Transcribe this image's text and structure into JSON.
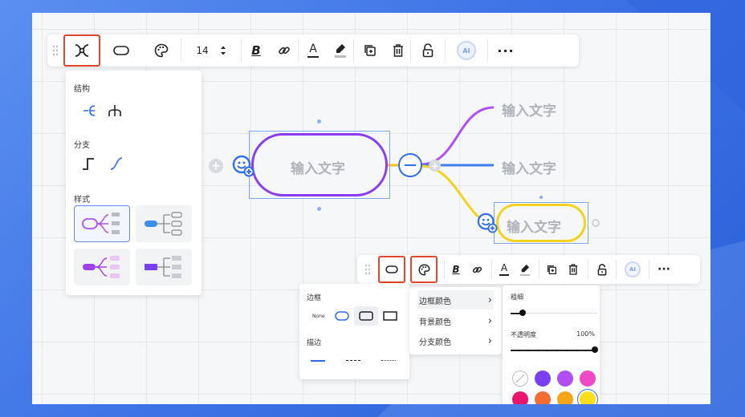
{
  "toolbar_main": {
    "font_size": "14",
    "bold_label": "B",
    "text_color_label": "A",
    "ai_label": "AI",
    "more_label": "···"
  },
  "structure_panel": {
    "structure_title": "结构",
    "branch_title": "分支",
    "style_title": "样式"
  },
  "mindmap": {
    "root_text": "输入文字",
    "child1_text": "输入文字",
    "child2_text": "输入文字",
    "child3_text": "输入文字",
    "colors": {
      "root": "#8a3df0",
      "child1": "#b24ff2",
      "child2": "#3d7ef0",
      "child3": "#f5d21b"
    }
  },
  "toolbar_small": {
    "bold_label": "B",
    "text_color_label": "A",
    "ai_label": "AI",
    "more_label": "···"
  },
  "border_panel": {
    "border_title": "边框",
    "none_label": "None",
    "stroke_title": "描边"
  },
  "color_menu": {
    "items": [
      {
        "label": "边框颜色",
        "arrow": "›"
      },
      {
        "label": "背景颜色",
        "arrow": "›"
      },
      {
        "label": "分支颜色",
        "arrow": "›"
      }
    ]
  },
  "color_panel": {
    "thickness_label": "粗细",
    "opacity_label": "不透明度",
    "opacity_value": "100%",
    "thickness_level": 0.1,
    "opacity_level": 1.0,
    "swatches": [
      "#ffffff",
      "#7b3ff2",
      "#b14ef0",
      "#ee49c7",
      "#e8146e",
      "#f36c34",
      "#f5a515",
      "#f7e019"
    ]
  }
}
